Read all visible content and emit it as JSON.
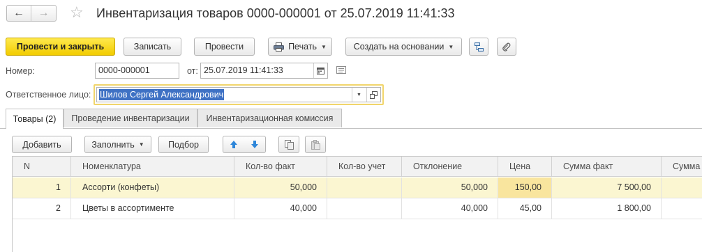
{
  "title": "Инвентаризация товаров 0000-000001 от 25.07.2019 11:41:33",
  "toolbar": {
    "post_close": "Провести и закрыть",
    "write": "Записать",
    "post": "Провести",
    "print": "Печать",
    "create_based": "Создать на основании"
  },
  "form": {
    "number_label": "Номер:",
    "number_value": "0000-000001",
    "date_label": "от:",
    "date_value": "25.07.2019 11:41:33",
    "responsible_label": "Ответственное лицо:",
    "responsible_value": "Шилов Сергей Александрович"
  },
  "tabs": [
    {
      "label": "Товары (2)",
      "active": true
    },
    {
      "label": "Проведение инвентаризации",
      "active": false
    },
    {
      "label": "Инвентаризационная комиссия",
      "active": false
    }
  ],
  "table_toolbar": {
    "add": "Добавить",
    "fill": "Заполнить",
    "select": "Подбор"
  },
  "table": {
    "columns": [
      "N",
      "Номенклатура",
      "Кол-во факт",
      "Кол-во учет",
      "Отклонение",
      "Цена",
      "Сумма факт",
      "Сумма"
    ],
    "rows": [
      {
        "n": "1",
        "item": "Ассорти (конфеты)",
        "qty_fact": "50,000",
        "qty_acc": "",
        "deviation": "50,000",
        "price": "150,00",
        "sum_fact": "7 500,00",
        "sum": ""
      },
      {
        "n": "2",
        "item": "Цветы в ассортименте",
        "qty_fact": "40,000",
        "qty_acc": "",
        "deviation": "40,000",
        "price": "45,00",
        "sum_fact": "1 800,00",
        "sum": ""
      }
    ]
  },
  "colors": {
    "primary_button": "#f2cc00",
    "selection": "#3e71c4",
    "selected_row": "#fbf6d1",
    "active_cell": "#f9e59e",
    "focus_border": "#f1d56b"
  }
}
